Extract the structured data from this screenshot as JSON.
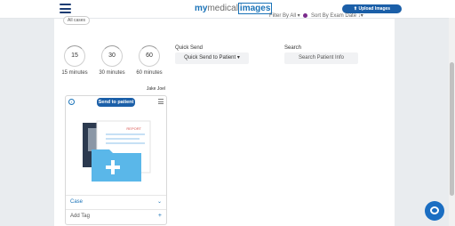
{
  "header": {
    "logo": {
      "my": "my",
      "medical": "medical",
      "images": "images"
    },
    "upload_label": "Upload Images"
  },
  "filters": {
    "pill": "All cases",
    "filter_text": "Filter By  All  ▾",
    "sort_text": "Sort By  Exam Date  ↓▾"
  },
  "quick_timers": [
    {
      "value": "15",
      "label": "15 minutes"
    },
    {
      "value": "30",
      "label": "30 minutes"
    },
    {
      "value": "60",
      "label": "60 minutes"
    }
  ],
  "quick_send": {
    "label": "Quick Send",
    "value": "Quick Send to Patient",
    "chevron": "▾"
  },
  "search": {
    "label": "Search",
    "placeholder": "Search Patient Info"
  },
  "card": {
    "patient_name": "Jake Joel",
    "send_label": "Send to patient",
    "report_text": "REPORT",
    "case_label": "Case",
    "add_tag_label": "Add Tag"
  },
  "colors": {
    "accent": "#1b5fa8",
    "brand_blue": "#1a73b8",
    "background": "#e9ecef"
  }
}
